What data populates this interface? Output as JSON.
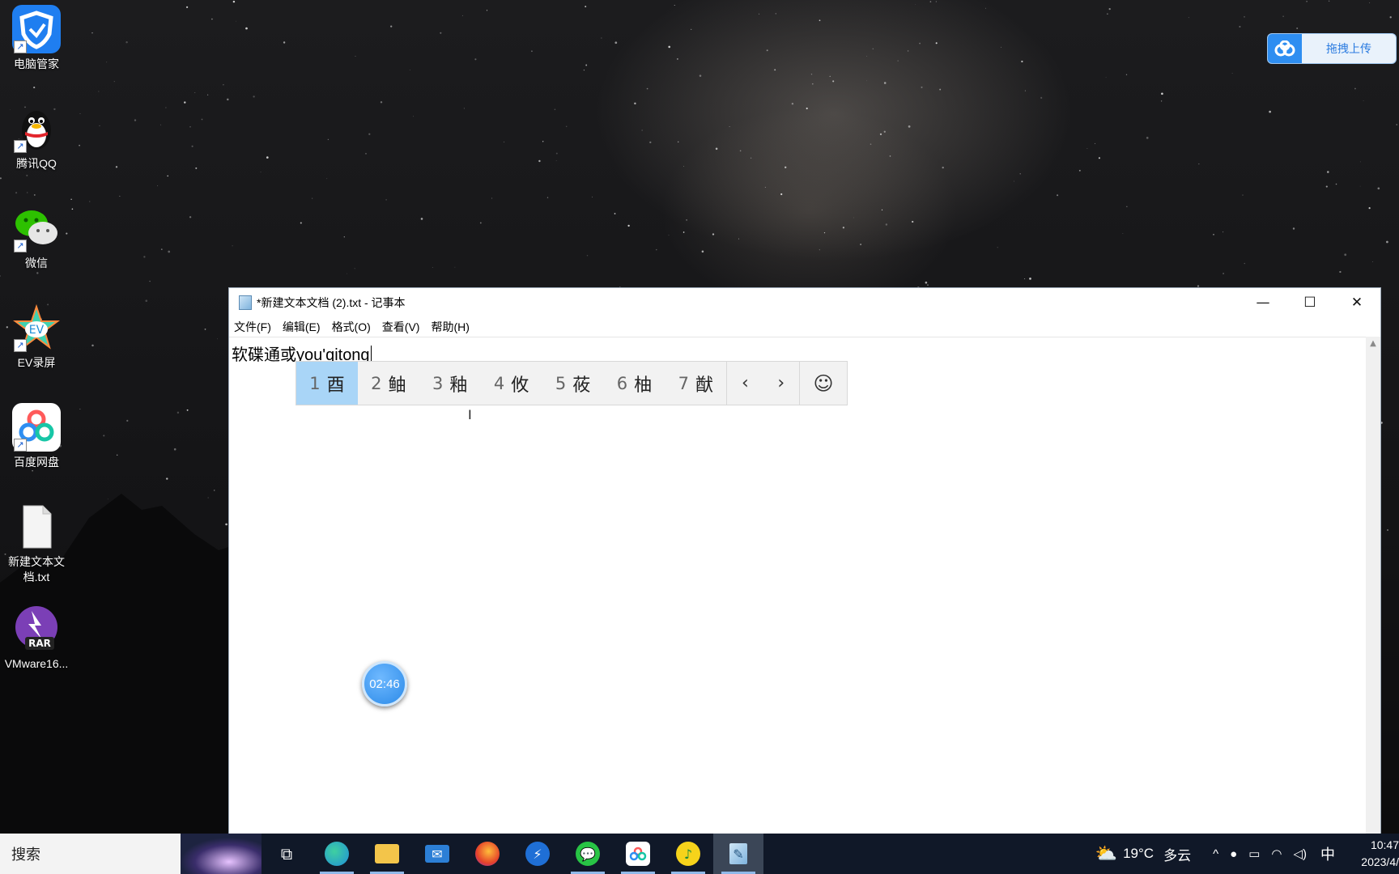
{
  "desktop": {
    "icons": [
      {
        "label": "电脑管家",
        "icon": "shield-icon"
      },
      {
        "label": "腾讯QQ",
        "icon": "qq-penguin-icon"
      },
      {
        "label": "微信",
        "icon": "wechat-icon"
      },
      {
        "label": "EV录屏",
        "icon": "ev-recorder-icon"
      },
      {
        "label": "百度网盘",
        "icon": "baidu-netdisk-icon"
      },
      {
        "label": "新建文本文档.txt",
        "icon": "text-file-icon"
      },
      {
        "label": "VMware16...",
        "icon": "winrar-icon",
        "badge": "RAR"
      }
    ],
    "upload_widget": {
      "label": "拖拽上传",
      "icon": "baidu-cloud-icon"
    }
  },
  "notepad": {
    "title": "*新建文本文档 (2).txt - 记事本",
    "menu": [
      "文件(F)",
      "编辑(E)",
      "格式(O)",
      "查看(V)",
      "帮助(H)"
    ],
    "text": "软碟通或",
    "composition": "you'qitong",
    "window_buttons": {
      "minimize": "—",
      "maximize": "☐",
      "close": "✕"
    }
  },
  "ime": {
    "candidates": [
      {
        "num": "1",
        "char": "酉",
        "selected": true
      },
      {
        "num": "2",
        "char": "鲉",
        "selected": false
      },
      {
        "num": "3",
        "char": "釉",
        "selected": false
      },
      {
        "num": "4",
        "char": "攸",
        "selected": false
      },
      {
        "num": "5",
        "char": "莜",
        "selected": false
      },
      {
        "num": "6",
        "char": "柚",
        "selected": false
      },
      {
        "num": "7",
        "char": "猷",
        "selected": false
      }
    ],
    "prev": "‹",
    "next": "›",
    "emoji": "☺",
    "selected_color": "#a9d5f7"
  },
  "timer": {
    "value": "02:46"
  },
  "taskbar": {
    "search_placeholder": "搜索",
    "apps": [
      {
        "name": "task-view",
        "icon": "task-view-icon",
        "glyph": "⧉",
        "color": "#101828"
      },
      {
        "name": "edge",
        "icon": "edge-icon",
        "glyph": "e",
        "color": "#1f8fd8"
      },
      {
        "name": "file-explorer",
        "icon": "folder-icon",
        "glyph": "▬",
        "color": "#f3c54a"
      },
      {
        "name": "mail",
        "icon": "mail-icon",
        "glyph": "✉",
        "color": "#2c7fd6"
      },
      {
        "name": "firefox",
        "icon": "firefox-icon",
        "glyph": "●",
        "color": "#e56a2a"
      },
      {
        "name": "feishu",
        "icon": "lightning-app-icon",
        "glyph": "⚡",
        "color": "#1f6fd6"
      },
      {
        "name": "wechat",
        "icon": "wechat-icon",
        "glyph": "●●",
        "color": "#28c445"
      },
      {
        "name": "baidu-netdisk",
        "icon": "baidu-netdisk-icon",
        "glyph": "∞",
        "color": "#ffffff"
      },
      {
        "name": "qq-music",
        "icon": "qq-music-icon",
        "glyph": "♪",
        "color": "#f6d31b"
      },
      {
        "name": "notepad",
        "icon": "notepad-icon",
        "glyph": "✎",
        "color": "#7fb3dd"
      }
    ],
    "weather": {
      "temp": "19°C",
      "desc": "多云",
      "icon": "cloudy-sun-icon"
    },
    "tray": {
      "chevron": "^",
      "mic": "🎤",
      "battery": "▭",
      "wifi": "◠",
      "volume": "🔈",
      "ime_mode": "中"
    },
    "clock": {
      "time": "10:47",
      "date": "2023/4/"
    }
  }
}
